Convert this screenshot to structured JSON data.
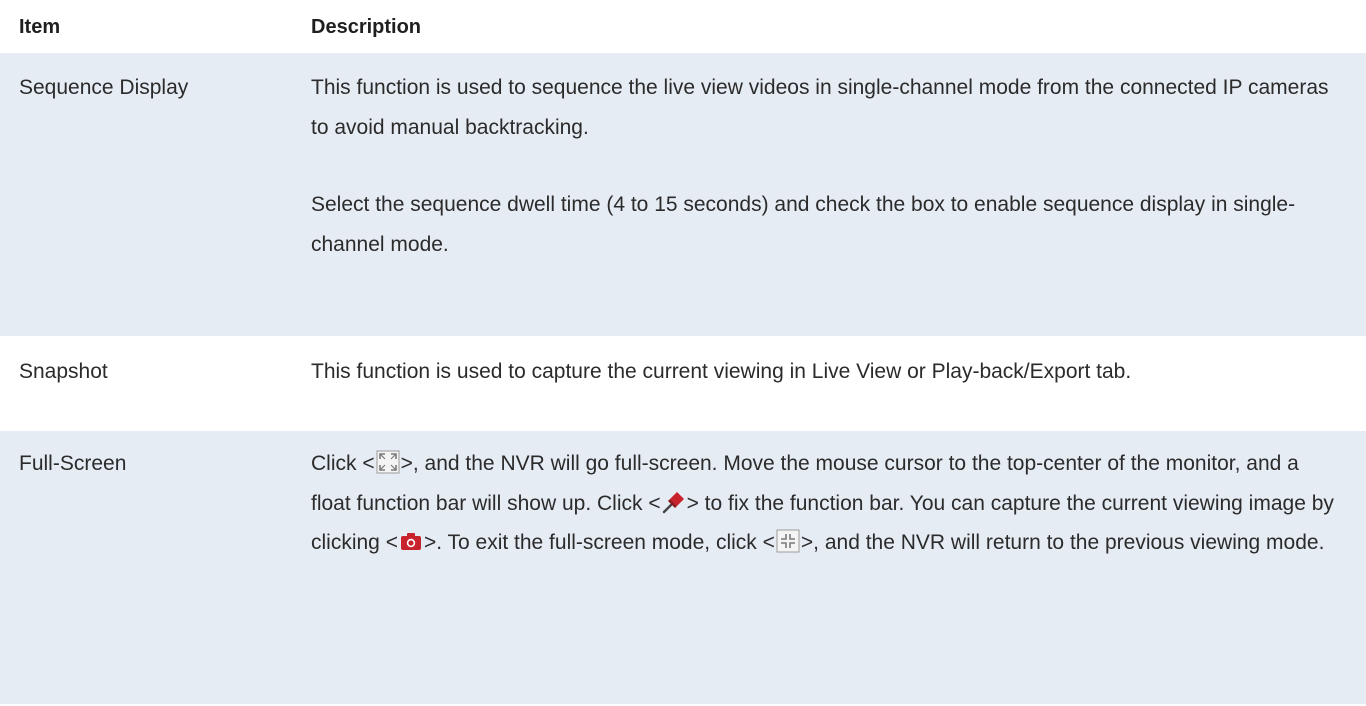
{
  "header": {
    "item_label": "Item",
    "description_label": "Description"
  },
  "rows": [
    {
      "item": "Sequence Display",
      "paragraphs": [
        "This function is used to sequence the live view videos in single-channel mode from the connected IP cameras to avoid manual backtracking.",
        "Select the sequence dwell time (4 to 15 seconds) and check the box to enable sequence display in single-channel mode."
      ]
    },
    {
      "item": "Snapshot",
      "paragraphs": [
        "This function is used to capture the current viewing in Live View or Play-back/Export tab."
      ]
    },
    {
      "item": "Full-Screen",
      "segments": {
        "s1": "Click <",
        "s2": ">, and the NVR will go full-screen. Move the mouse cursor to the top-center of the monitor, and a float function bar will show up. Click <",
        "s3": "> to fix the function bar. You can capture the current viewing image by clicking <",
        "s4": ">. To exit the full-screen mode, click <",
        "s5": ">, and the NVR will return to the previous viewing mode."
      },
      "icons": [
        "fullscreen-icon",
        "pin-icon",
        "camera-icon",
        "exit-fullscreen-icon"
      ]
    }
  ],
  "colors": {
    "shaded_row": "#e6ecf4",
    "text": "#2b2b2b",
    "icon_red": "#c8232c",
    "icon_gray": "#7a7a7a"
  }
}
